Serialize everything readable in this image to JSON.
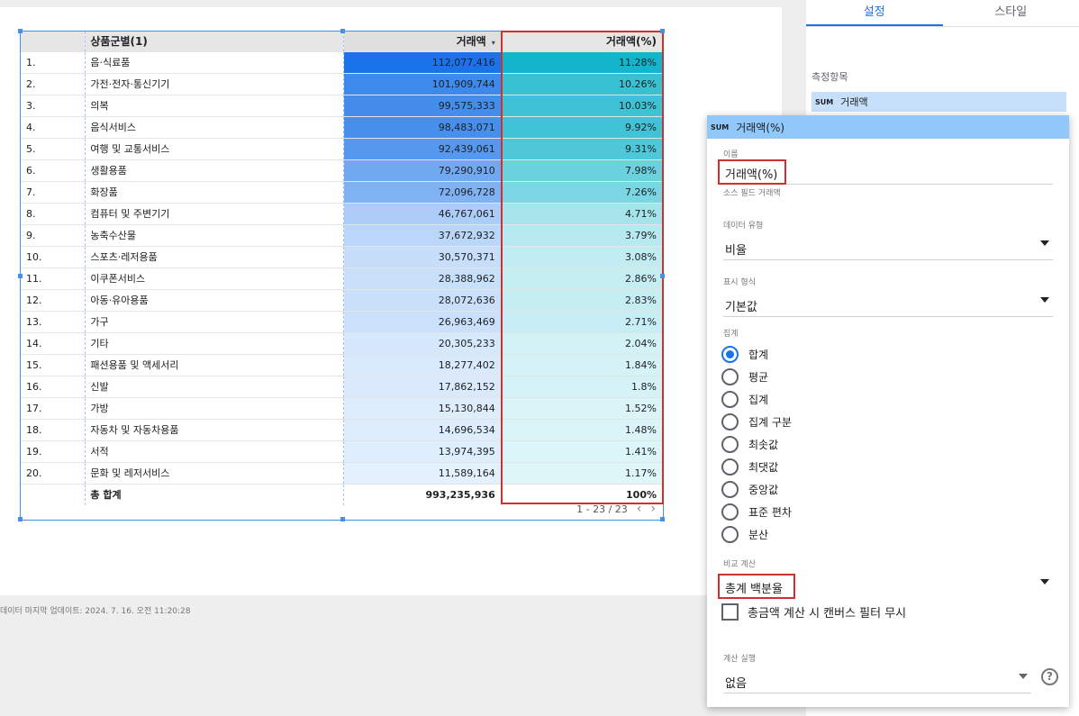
{
  "table": {
    "headers": {
      "num": "",
      "category": "상품군별(1)",
      "amount": "거래액",
      "percent": "거래액(%)"
    },
    "rows": [
      {
        "num": "1.",
        "category": "음·식료품",
        "amount": "112,077,416",
        "percent": "11.28%"
      },
      {
        "num": "2.",
        "category": "가전·전자·통신기기",
        "amount": "101,909,744",
        "percent": "10.26%"
      },
      {
        "num": "3.",
        "category": "의복",
        "amount": "99,575,333",
        "percent": "10.03%"
      },
      {
        "num": "4.",
        "category": "음식서비스",
        "amount": "98,483,071",
        "percent": "9.92%"
      },
      {
        "num": "5.",
        "category": "여행 및 교통서비스",
        "amount": "92,439,061",
        "percent": "9.31%"
      },
      {
        "num": "6.",
        "category": "생활용품",
        "amount": "79,290,910",
        "percent": "7.98%"
      },
      {
        "num": "7.",
        "category": "화장품",
        "amount": "72,096,728",
        "percent": "7.26%"
      },
      {
        "num": "8.",
        "category": "컴퓨터 및 주변기기",
        "amount": "46,767,061",
        "percent": "4.71%"
      },
      {
        "num": "9.",
        "category": "농축수산물",
        "amount": "37,672,932",
        "percent": "3.79%"
      },
      {
        "num": "10.",
        "category": "스포츠·레저용품",
        "amount": "30,570,371",
        "percent": "3.08%"
      },
      {
        "num": "11.",
        "category": "이쿠폰서비스",
        "amount": "28,388,962",
        "percent": "2.86%"
      },
      {
        "num": "12.",
        "category": "아동·유아용품",
        "amount": "28,072,636",
        "percent": "2.83%"
      },
      {
        "num": "13.",
        "category": "가구",
        "amount": "26,963,469",
        "percent": "2.71%"
      },
      {
        "num": "14.",
        "category": "기타",
        "amount": "20,305,233",
        "percent": "2.04%"
      },
      {
        "num": "15.",
        "category": "패션용품 및 액세서리",
        "amount": "18,277,402",
        "percent": "1.84%"
      },
      {
        "num": "16.",
        "category": "신발",
        "amount": "17,862,152",
        "percent": "1.8%"
      },
      {
        "num": "17.",
        "category": "가방",
        "amount": "15,130,844",
        "percent": "1.52%"
      },
      {
        "num": "18.",
        "category": "자동차 및 자동차용품",
        "amount": "14,696,534",
        "percent": "1.48%"
      },
      {
        "num": "19.",
        "category": "서적",
        "amount": "13,974,395",
        "percent": "1.41%"
      },
      {
        "num": "20.",
        "category": "문화 및 레저서비스",
        "amount": "11,589,164",
        "percent": "1.17%"
      }
    ],
    "total": {
      "label": "총 합계",
      "amount": "993,235,936",
      "percent": "100%"
    },
    "pagination": "1 - 23 / 23",
    "prev_icon": "‹",
    "next_icon": "›",
    "sort_icon": "▾",
    "colors": {
      "amount_heat_max": "#1a73e8",
      "amount_heat_min": "#e3f0fd",
      "percent_heat_max": "#12b5cb",
      "percent_heat_min": "#dff6f9"
    }
  },
  "last_update": "데이터 마지막 업데이트: 2024. 7. 16. 오전 11:20:28",
  "panel": {
    "tabs": [
      "설정",
      "스타일"
    ],
    "metrics_label": "측정항목",
    "metric_chip": {
      "badge": "SUM",
      "label": "거래액"
    }
  },
  "popup": {
    "header_badge": "SUM",
    "header_title": "거래액(%)",
    "name_label": "이름",
    "name_value": "거래액(%)",
    "source_field": "소스 필드 거래액",
    "data_type_label": "데이터 유형",
    "data_type_value": "비율",
    "format_label": "표시 형식",
    "format_value": "기본값",
    "aggregation_label": "집계",
    "aggregations": [
      {
        "label": "합계",
        "checked": true
      },
      {
        "label": "평균",
        "checked": false
      },
      {
        "label": "집계",
        "checked": false
      },
      {
        "label": "집계 구분",
        "checked": false
      },
      {
        "label": "최솟값",
        "checked": false
      },
      {
        "label": "최댓값",
        "checked": false
      },
      {
        "label": "중앙값",
        "checked": false
      },
      {
        "label": "표준 편차",
        "checked": false
      },
      {
        "label": "분산",
        "checked": false
      }
    ],
    "comparison_label": "비교 계산",
    "comparison_value": "총계 백분율",
    "ignore_filter_label": "총금액 계산 시 캔버스 필터 무시",
    "running_calc_label": "계산 실행",
    "running_calc_value": "없음",
    "help_icon": "?"
  }
}
